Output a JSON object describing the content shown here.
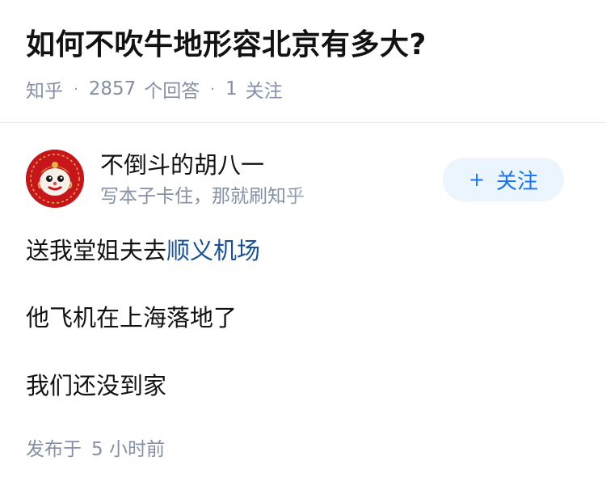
{
  "question": {
    "title": "如何不吹牛地形容北京有多大?",
    "source": "知乎",
    "answer_count": "2857",
    "answer_label": "个回答",
    "follow_count": "1",
    "follow_label": "关注"
  },
  "author": {
    "name": "不倒斗的胡八一",
    "bio": "写本子卡住，那就刷知乎",
    "avatar": "lion-dance-avatar",
    "follow_button": {
      "icon": "+",
      "label": "关注"
    }
  },
  "answer": {
    "p1_text": "送我堂姐夫去",
    "p1_link": "顺义机场",
    "p2": "他飞机在上海落地了",
    "p3": "我们还没到家"
  },
  "footer": {
    "published_label": "发布于",
    "published_time": "5 小时前"
  },
  "colors": {
    "link": "#175199",
    "accent": "#1772f6",
    "muted": "#8590a6",
    "button_bg": "#ebf5fd"
  }
}
